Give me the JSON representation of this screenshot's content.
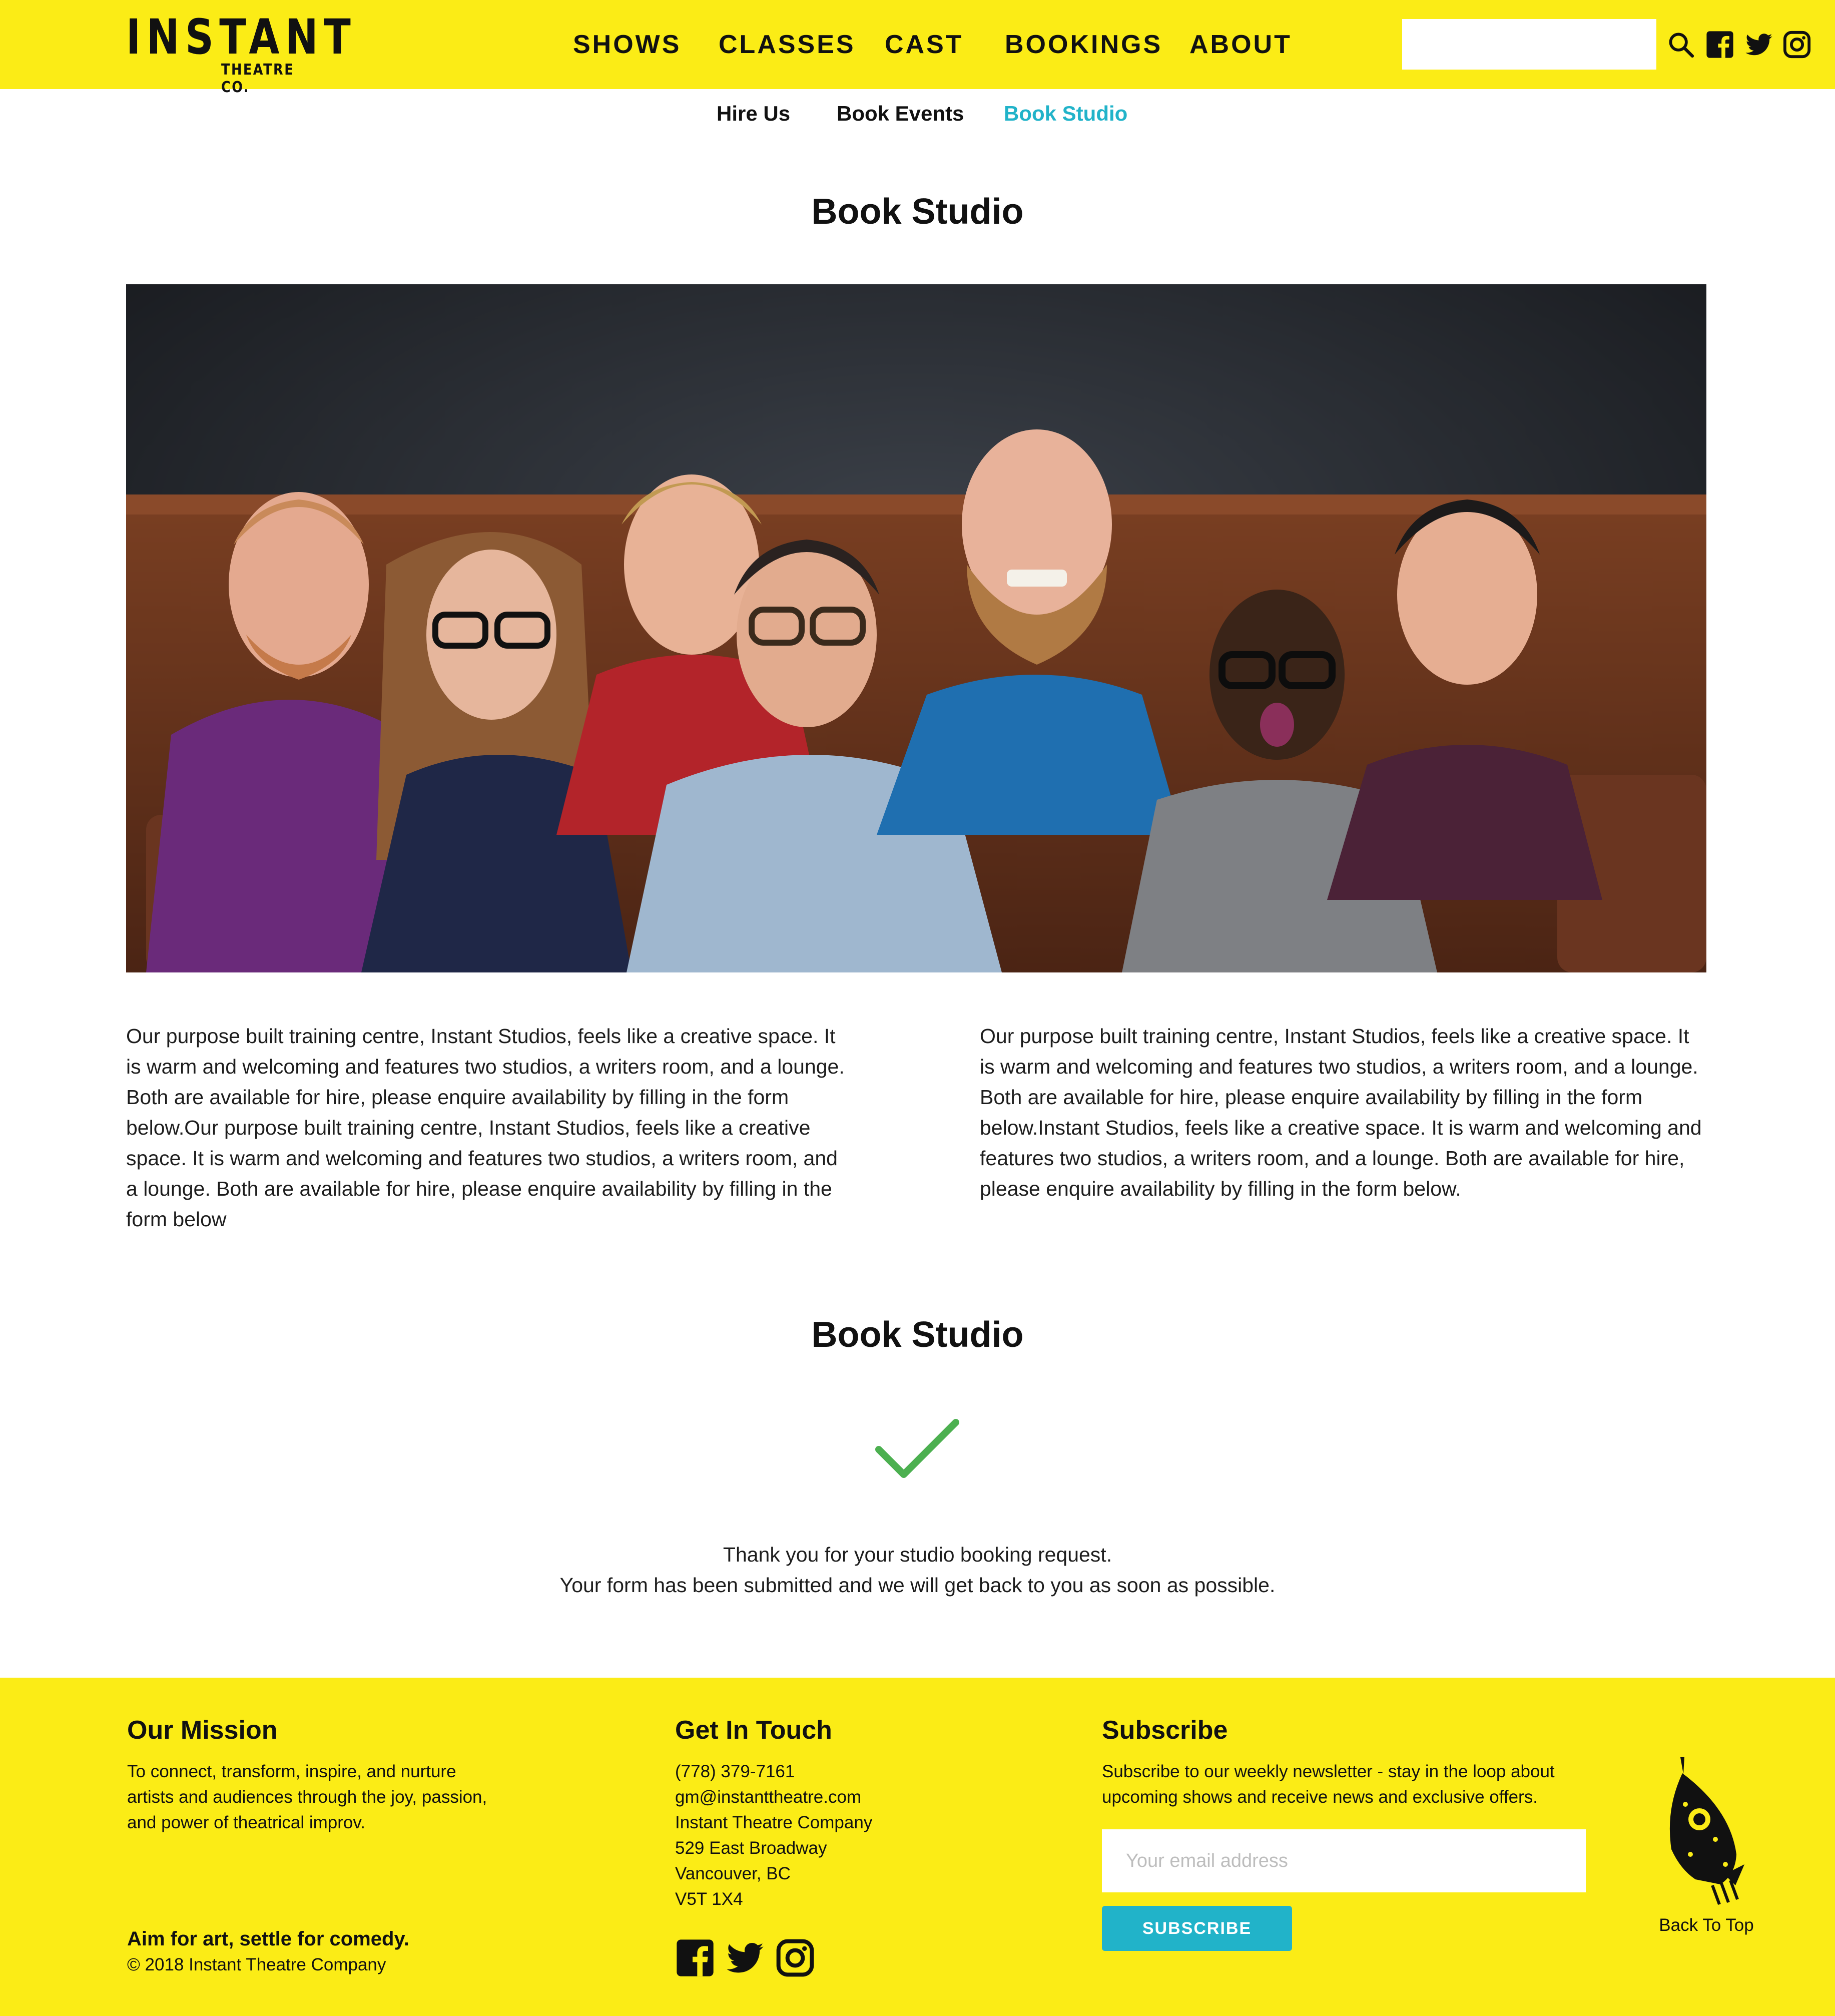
{
  "header": {
    "logo": {
      "main": "INSTANT",
      "sub": "THEATRE CO."
    },
    "nav": [
      "SHOWS",
      "CLASSES",
      "CAST",
      "BOOKINGS",
      "ABOUT"
    ],
    "search": {
      "value": "",
      "placeholder": ""
    },
    "icons": [
      "search-icon",
      "facebook-icon",
      "twitter-icon",
      "instagram-icon"
    ],
    "color": "#fbec16"
  },
  "subnav": {
    "items": [
      "Hire Us",
      "Book Events",
      "Book Studio"
    ],
    "active": "Book Studio",
    "active_color": "#21b3c9"
  },
  "page": {
    "title": "Book Studio",
    "paragraph_left": "Our purpose built training centre, Instant Studios, feels like a creative space. It is warm and welcoming and features two studios, a writers room, and a lounge. Both are available for hire, please enquire availability by filling in the form below.Our purpose built training centre, Instant Studios, feels like a creative space. It is warm and welcoming and features two studios, a writers room, and a lounge. Both are available for hire, please enquire availability by filling in the form below",
    "paragraph_right": "Our purpose built training centre, Instant Studios, feels like a creative space. It is warm and welcoming and features two studios, a writers room, and a lounge. Both are available for hire, please enquire availability by filling in the form below.Instant Studios, feels like a creative space. It is warm and welcoming and features two studios, a writers room, and a lounge. Both are available for hire, please enquire availability by filling in the form below."
  },
  "confirmation": {
    "title": "Book Studio",
    "icon": "checkmark-icon",
    "icon_color": "#4cb050",
    "line1": "Thank you for your studio booking request.",
    "line2": "Your form has been submitted and we will get back to you as soon as possible."
  },
  "footer": {
    "mission": {
      "heading": "Our Mission",
      "lines": [
        "To connect, transform, inspire, and nurture",
        "artists and audiences through the joy, passion,",
        "and power of theatrical improv."
      ],
      "tagline": "Aim for art, settle for comedy.",
      "copyright": "© 2018 Instant Theatre Company"
    },
    "contact": {
      "heading": "Get In Touch",
      "lines": [
        "(778) 379-7161",
        "gm@instanttheatre.com",
        "Instant Theatre Company",
        "529 East Broadway",
        "Vancouver, BC",
        "V5T 1X4"
      ],
      "icons": [
        "facebook-icon",
        "twitter-icon",
        "instagram-icon"
      ]
    },
    "subscribe": {
      "heading": "Subscribe",
      "lines": [
        "Subscribe to our weekly newsletter - stay in the loop about",
        "upcoming shows and receive news and exclusive offers."
      ],
      "email_placeholder": "Your email address",
      "email_value": "",
      "button_label": "SUBSCRIBE",
      "button_color": "#21b3c9"
    },
    "back_to_top": "Back To Top"
  }
}
